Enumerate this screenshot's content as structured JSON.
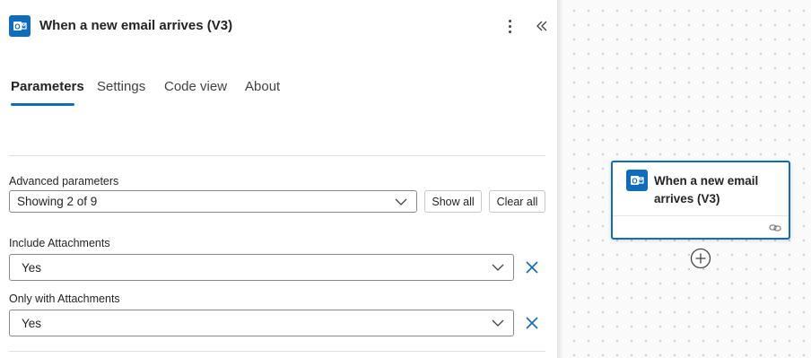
{
  "header": {
    "title": "When a new email arrives (V3)",
    "icon": "outlook-icon",
    "brand_color": "#0f6cbd"
  },
  "tabs": [
    {
      "label": "Parameters",
      "active": true
    },
    {
      "label": "Settings",
      "active": false
    },
    {
      "label": "Code view",
      "active": false
    },
    {
      "label": "About",
      "active": false
    }
  ],
  "advanced": {
    "label": "Advanced parameters",
    "value": "Showing 2 of 9",
    "show_all_label": "Show all",
    "clear_all_label": "Clear all"
  },
  "fields": [
    {
      "label": "Include Attachments",
      "value": "Yes"
    },
    {
      "label": "Only with Attachments",
      "value": "Yes"
    }
  ],
  "canvas": {
    "card_title": "When a new email arrives (V3)"
  }
}
